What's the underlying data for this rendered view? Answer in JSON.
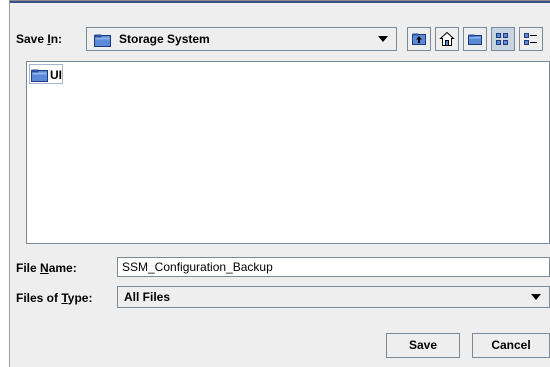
{
  "save_in": {
    "label_prefix": "Save ",
    "label_mnemonic": "I",
    "label_suffix": "n:",
    "current_folder": "Storage System"
  },
  "toolbar": {
    "up_icon": "up-folder-icon",
    "home_icon": "home-icon",
    "new_folder_icon": "new-folder-icon",
    "list_view_icon": "list-view-icon",
    "details_view_icon": "details-view-icon"
  },
  "file_list": {
    "items": [
      {
        "name": "UI",
        "icon": "folder-icon"
      }
    ]
  },
  "file_name": {
    "label_prefix": "File ",
    "label_mnemonic": "N",
    "label_suffix": "ame:",
    "value": "SSM_Configuration_Backup"
  },
  "file_type": {
    "label_prefix": "Files of ",
    "label_mnemonic": "T",
    "label_suffix": "ype:",
    "selected": "All Files"
  },
  "buttons": {
    "save": "Save",
    "cancel": "Cancel"
  },
  "colors": {
    "folder_fill": "#5b8bd8",
    "folder_tab": "#2c4f9e",
    "panel_bg": "#eeeeee",
    "border": "#7a8a99"
  }
}
